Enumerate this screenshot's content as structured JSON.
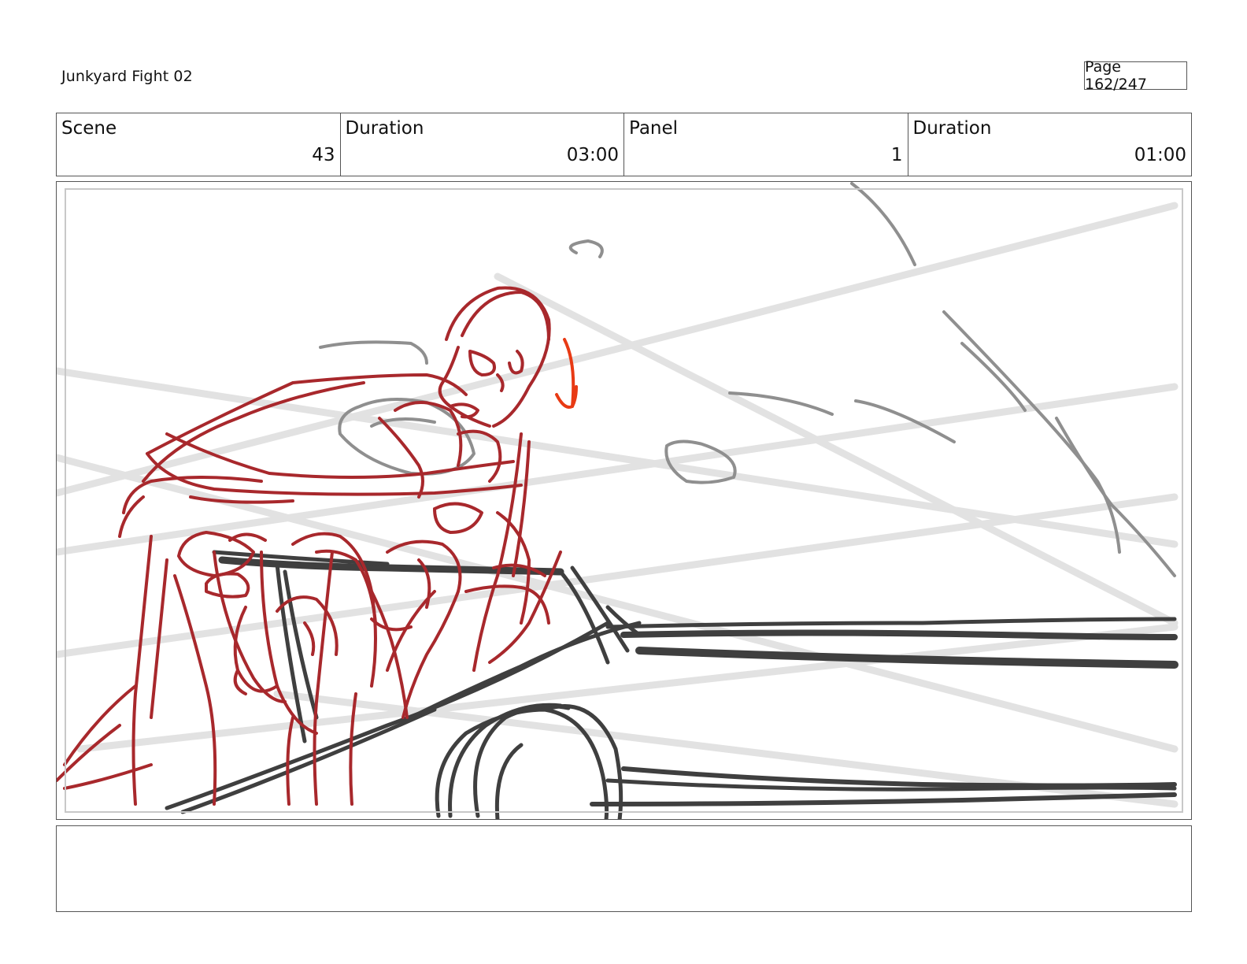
{
  "header": {
    "project_title": "Junkyard Fight 02",
    "page_label": "Page 162/247"
  },
  "info": {
    "scene_label": "Scene",
    "scene_value": "43",
    "scene_duration_label": "Duration",
    "scene_duration_value": "03:00",
    "panel_label": "Panel",
    "panel_value": "1",
    "panel_duration_label": "Duration",
    "panel_duration_value": "01:00"
  },
  "sketch": {
    "colors": {
      "character": "#a8282c",
      "action_arrow": "#e83a14",
      "car": "#3f3f3f",
      "background": "#8f8f8f",
      "speed_lines": "#e2e2e2"
    }
  },
  "notes": {
    "text": ""
  }
}
